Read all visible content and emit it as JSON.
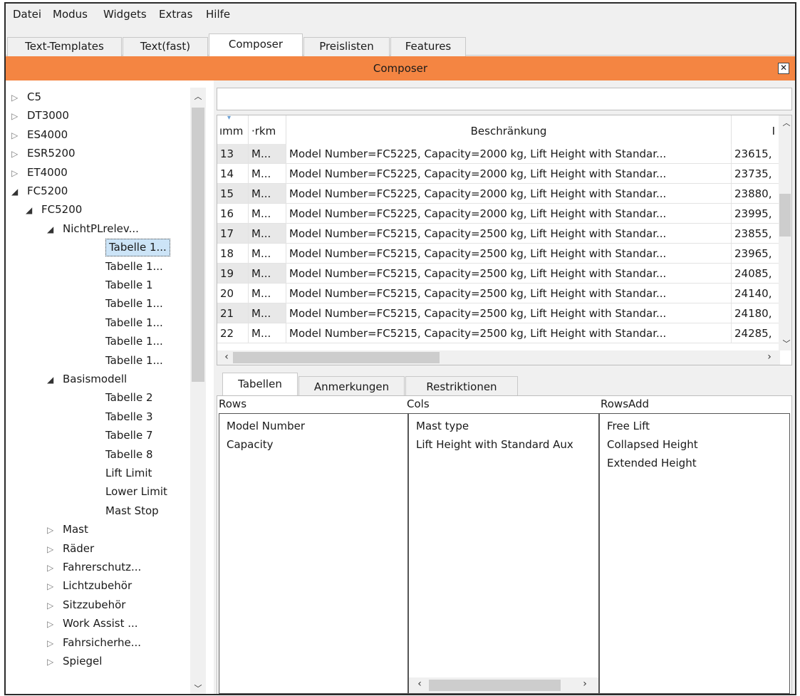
{
  "menu": [
    "Datei",
    "Modus",
    "Widgets",
    "Extras",
    "Hilfe"
  ],
  "tabs": [
    "Text-Templates",
    "Text(fast)",
    "Composer",
    "Preislisten",
    "Features"
  ],
  "active_tab": "Composer",
  "panel_title": "Composer",
  "tree": [
    {
      "label": "C5",
      "level": 0,
      "expander": "collapsed"
    },
    {
      "label": "DT3000",
      "level": 0,
      "expander": "collapsed"
    },
    {
      "label": "ES4000",
      "level": 0,
      "expander": "collapsed"
    },
    {
      "label": "ESR5200",
      "level": 0,
      "expander": "collapsed"
    },
    {
      "label": "ET4000",
      "level": 0,
      "expander": "collapsed"
    },
    {
      "label": "FC5200",
      "level": 0,
      "expander": "expanded"
    },
    {
      "label": "FC5200",
      "level": 1,
      "expander": "expanded"
    },
    {
      "label": "NichtPLrelev...",
      "level": 2,
      "expander": "expanded"
    },
    {
      "label": "Tabelle 1...",
      "level": 3,
      "expander": "none",
      "selected": true
    },
    {
      "label": "Tabelle 1...",
      "level": 3,
      "expander": "none"
    },
    {
      "label": "Tabelle 1",
      "level": 3,
      "expander": "none"
    },
    {
      "label": "Tabelle 1...",
      "level": 3,
      "expander": "none"
    },
    {
      "label": "Tabelle 1...",
      "level": 3,
      "expander": "none"
    },
    {
      "label": "Tabelle 1...",
      "level": 3,
      "expander": "none"
    },
    {
      "label": "Tabelle 1...",
      "level": 3,
      "expander": "none"
    },
    {
      "label": "Basismodell",
      "level": 2,
      "expander": "expanded"
    },
    {
      "label": "Tabelle 2",
      "level": 3,
      "expander": "none"
    },
    {
      "label": "Tabelle 3",
      "level": 3,
      "expander": "none"
    },
    {
      "label": "Tabelle 7",
      "level": 3,
      "expander": "none"
    },
    {
      "label": "Tabelle 8",
      "level": 3,
      "expander": "none"
    },
    {
      "label": "Lift Limit",
      "level": 3,
      "expander": "none"
    },
    {
      "label": "Lower Limit",
      "level": 3,
      "expander": "none"
    },
    {
      "label": "Mast Stop",
      "level": 3,
      "expander": "none"
    },
    {
      "label": "Mast",
      "level": 2,
      "expander": "collapsed"
    },
    {
      "label": "Räder",
      "level": 2,
      "expander": "collapsed"
    },
    {
      "label": "Fahrerschutz...",
      "level": 2,
      "expander": "collapsed"
    },
    {
      "label": "Lichtzubehör",
      "level": 2,
      "expander": "collapsed"
    },
    {
      "label": "Sitzzubehör",
      "level": 2,
      "expander": "collapsed"
    },
    {
      "label": "Work Assist ...",
      "level": 2,
      "expander": "collapsed"
    },
    {
      "label": "Fahrsicherhe...",
      "level": 2,
      "expander": "collapsed"
    },
    {
      "label": "Spiegel",
      "level": 2,
      "expander": "collapsed"
    }
  ],
  "filter_value": "",
  "grid": {
    "columns": [
      "ımm",
      "·rkm",
      "Beschränkung",
      "I"
    ],
    "rows": [
      [
        "13",
        "M...",
        "Model Number=FC5225, Capacity=2000 kg, Lift Height with Standar...",
        "23615,"
      ],
      [
        "14",
        "M...",
        "Model Number=FC5225, Capacity=2000 kg, Lift Height with Standar...",
        "23735,"
      ],
      [
        "15",
        "M...",
        "Model Number=FC5225, Capacity=2000 kg, Lift Height with Standar...",
        "23880,"
      ],
      [
        "16",
        "M...",
        "Model Number=FC5225, Capacity=2000 kg, Lift Height with Standar...",
        "23995,"
      ],
      [
        "17",
        "M...",
        "Model Number=FC5215, Capacity=2500 kg, Lift Height with Standar...",
        "23855,"
      ],
      [
        "18",
        "M...",
        "Model Number=FC5215, Capacity=2500 kg, Lift Height with Standar...",
        "23965,"
      ],
      [
        "19",
        "M...",
        "Model Number=FC5215, Capacity=2500 kg, Lift Height with Standar...",
        "24085,"
      ],
      [
        "20",
        "M...",
        "Model Number=FC5215, Capacity=2500 kg, Lift Height with Standar...",
        "24140,"
      ],
      [
        "21",
        "M...",
        "Model Number=FC5215, Capacity=2500 kg, Lift Height with Standar...",
        "24180,"
      ],
      [
        "22",
        "M...",
        "Model Number=FC5215, Capacity=2500 kg, Lift Height with Standar...",
        "24285,"
      ]
    ]
  },
  "bottom_tabs": [
    "Tabellen",
    "Anmerkungen",
    "Restriktionen"
  ],
  "active_bottom_tab": "Tabellen",
  "lists": [
    {
      "header": "Rows",
      "items": [
        "Model Number",
        "Capacity"
      ]
    },
    {
      "header": "Cols",
      "items": [
        "Mast type",
        "Lift Height with Standard Aux"
      ]
    },
    {
      "header": "RowsAdd",
      "items": [
        "Free Lift",
        "Collapsed Height",
        "Extended Height"
      ]
    }
  ],
  "icons": {
    "close": "close-x-icon",
    "collapsed": "triangle-right-outline-icon",
    "expanded": "triangle-down-filled-icon",
    "scroll_up": "chevron-up-icon",
    "scroll_down": "chevron-down-icon",
    "scroll_left": "chevron-left-icon",
    "scroll_right": "chevron-right-icon"
  },
  "colors": {
    "accent_header": "#f48542",
    "selection": "#cce4f7"
  }
}
